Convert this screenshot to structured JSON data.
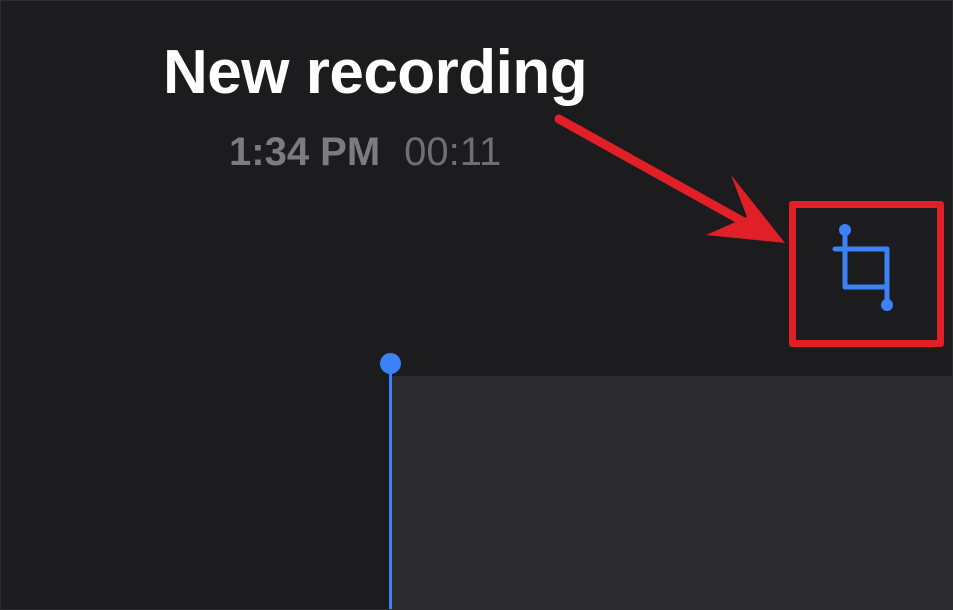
{
  "recording": {
    "title": "New recording",
    "time": "1:34 PM",
    "duration": "00:11"
  },
  "toolbar": {
    "trim_icon": "trim-icon"
  },
  "colors": {
    "background": "#1c1c1e",
    "panel": "#2c2c2e",
    "accent": "#3b82f6",
    "annotation": "#e01f26",
    "title_text": "#ffffff",
    "meta_text": "#7c7c80"
  }
}
